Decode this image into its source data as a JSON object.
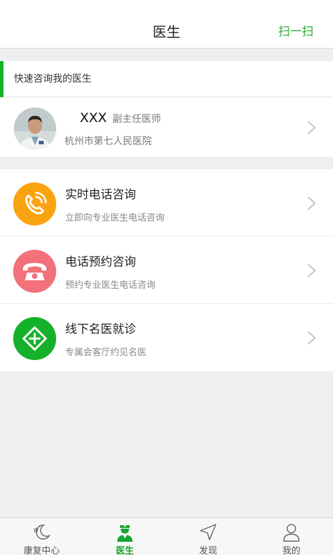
{
  "header": {
    "title": "医生",
    "scan_label": "扫一扫"
  },
  "section": {
    "title": "快速咨询我的医生"
  },
  "doctor": {
    "name": "XXX",
    "title": "副主任医师",
    "hospital": "杭州市第七人民医院"
  },
  "services": [
    {
      "label": "实时电话咨询",
      "desc": "立即向专业医生电话咨询",
      "icon": "phone-ringing-icon",
      "color": "#f9a310"
    },
    {
      "label": "电话预约咨询",
      "desc": "预约专业医生电话咨询",
      "icon": "telephone-icon",
      "color": "#f2717a"
    },
    {
      "label": "线下名医就诊",
      "desc": "专属会客厅约见名医",
      "icon": "medical-cross-icon",
      "color": "#16b12a"
    }
  ],
  "tabs": [
    {
      "label": "康复中心",
      "icon": "moon-stars-icon",
      "active": false
    },
    {
      "label": "医生",
      "icon": "doctor-icon",
      "active": true
    },
    {
      "label": "发现",
      "icon": "compass-arrow-icon",
      "active": false
    },
    {
      "label": "我的",
      "icon": "person-icon",
      "active": false
    }
  ],
  "colors": {
    "accent": "#13b32a",
    "background": "#eeeff1"
  }
}
